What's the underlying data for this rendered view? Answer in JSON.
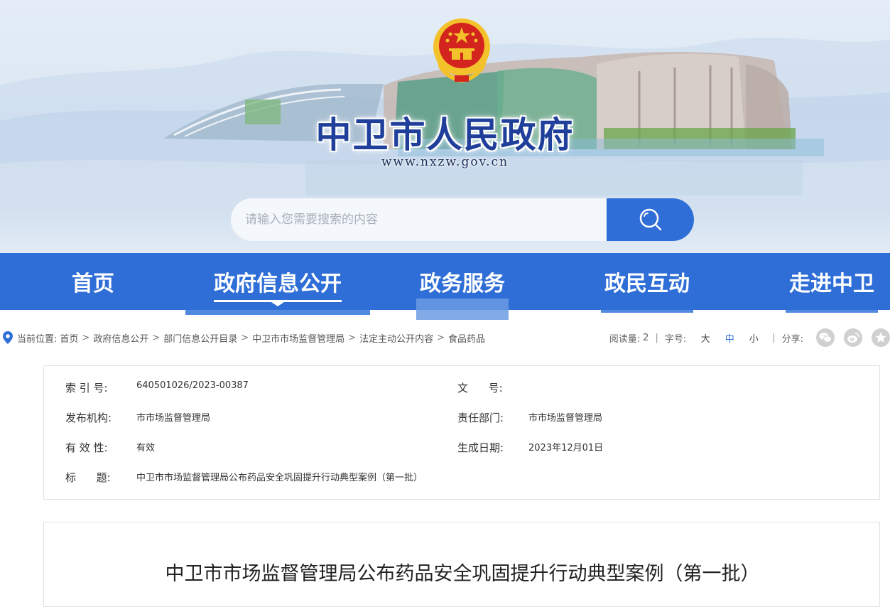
{
  "site": {
    "name": "中卫市人民政府",
    "url": "www.nxzw.gov.cn"
  },
  "search": {
    "placeholder": "请输入您需要搜索的内容"
  },
  "nav": {
    "items": [
      {
        "label": "首页"
      },
      {
        "label": "政府信息公开"
      },
      {
        "label": "政务服务"
      },
      {
        "label": "政民互动"
      },
      {
        "label": "走进中卫"
      }
    ],
    "active_index": 1
  },
  "breadcrumb": {
    "prefix": "当前位置:",
    "items": [
      "首页",
      "政府信息公开",
      "部门信息公开目录",
      "中卫市市场监督管理局",
      "法定主动公开内容",
      "食品药品"
    ],
    "separator": ">"
  },
  "tools": {
    "read_label": "阅读量:",
    "read_count": "2",
    "font_label": "字号:",
    "font_sizes": [
      "大",
      "中",
      "小"
    ],
    "font_active": "中",
    "share_label": "分享:",
    "share_icons": [
      "wechat-icon",
      "weibo-icon",
      "favorite-icon"
    ],
    "divider": "|"
  },
  "info": {
    "index_label": "索 引 号:",
    "index_value": "640501026/2023-00387",
    "docno_label": "文      号:",
    "docno_value": "",
    "publisher_label": "发布机构:",
    "publisher_value": "市市场监督管理局",
    "dept_label": "责任部门:",
    "dept_value": "市市场监督管理局",
    "validity_label": "有 效 性:",
    "validity_value": "有效",
    "date_label": "生成日期:",
    "date_value": "2023年12月01日",
    "title_label": "标      题:",
    "title_value": "中卫市市场监督管理局公布药品安全巩固提升行动典型案例（第一批）"
  },
  "article": {
    "title": "中卫市市场监督管理局公布药品安全巩固提升行动典型案例（第一批）"
  },
  "colors": {
    "primary": "#2f6ed6",
    "title_blue": "#1f3f9a",
    "emblem_red": "#d3251e",
    "emblem_gold": "#f3c22b"
  }
}
